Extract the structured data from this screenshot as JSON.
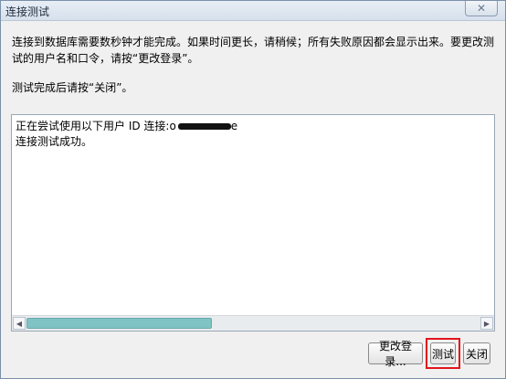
{
  "window": {
    "title": "连接测试",
    "close_glyph": "✕"
  },
  "content": {
    "instructions": "连接到数据库需要数秒钟才能完成。如果时间更长，请稍候；所有失败原因都会显示出来。要更改测试的用户名和口令，请按“更改登录”。",
    "close_hint": "测试完成后请按“关闭”。"
  },
  "output": {
    "line1_prefix": "正在尝试使用以下用户 ID 连接:",
    "line1_visible_start": "o",
    "line1_visible_end": "e",
    "line2": "连接测试成功。",
    "hscroll_thumb_fraction": 0.41
  },
  "buttons": {
    "change_login": "更改登录...",
    "test": "测试",
    "close": "关闭"
  },
  "colors": {
    "highlight": "#e3141c",
    "scroll_thumb": "#7fc3c5"
  },
  "icons": {
    "close": "close-icon",
    "scroll_left": "arrow-left-icon",
    "scroll_right": "arrow-right-icon"
  }
}
